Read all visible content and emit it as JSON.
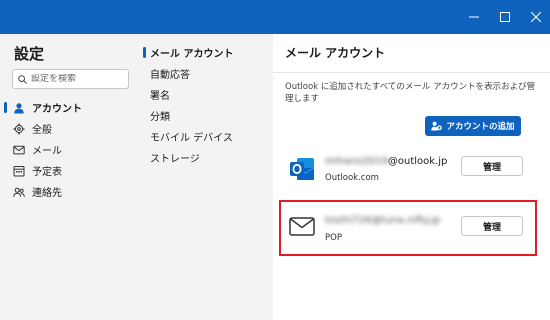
{
  "window": {
    "controls": [
      "minimize-icon",
      "maximize-icon",
      "close-icon"
    ]
  },
  "settings": {
    "title": "設定",
    "search_placeholder": "設定を検索",
    "nav": [
      {
        "label": "アカウント",
        "icon": "person-icon",
        "active": true
      },
      {
        "label": "全般",
        "icon": "gear-icon",
        "active": false
      },
      {
        "label": "メール",
        "icon": "mail-icon",
        "active": false
      },
      {
        "label": "予定表",
        "icon": "calendar-icon",
        "active": false
      },
      {
        "label": "連絡先",
        "icon": "contacts-icon",
        "active": false
      }
    ],
    "subnav": [
      {
        "label": "メール アカウント",
        "active": true
      },
      {
        "label": "自動応答",
        "active": false
      },
      {
        "label": "署名",
        "active": false
      },
      {
        "label": "分類",
        "active": false
      },
      {
        "label": "モバイル デバイス",
        "active": false
      },
      {
        "label": "ストレージ",
        "active": false
      }
    ]
  },
  "panel": {
    "title": "メール アカウント",
    "description": "Outlook に追加されたすべてのメール アカウントを表示および管理します",
    "add_account_label": "アカウントの追加",
    "accounts": [
      {
        "email_user": "mihano2019",
        "email_domain": "@outlook.jp",
        "type": "Outlook.com",
        "icon": "outlook-logo-icon",
        "manage_label": "管理"
      },
      {
        "email_user": "tosihi726",
        "email_domain": "@tuna.nifty.jp",
        "type": "POP",
        "icon": "envelope-icon",
        "manage_label": "管理"
      }
    ]
  },
  "colors": {
    "accent": "#0f63bd",
    "highlight": "#e31c23",
    "sidebar_bg": "#f3f3f3"
  }
}
